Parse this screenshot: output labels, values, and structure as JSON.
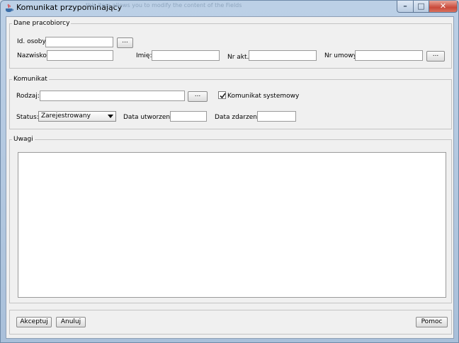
{
  "window": {
    "title": "Komunikat przypominający",
    "ghost_text": "this item allows you to modify the content of the Fields"
  },
  "pracobiorca": {
    "legend": "Dane pracobiorcy",
    "id_label": "Id. osoby:",
    "id_value": "",
    "nazwisko_label": "Nazwisko:",
    "nazwisko_value": "",
    "imie_label": "Imię:",
    "imie_value": "",
    "nr_akt_label": "Nr akt.:",
    "nr_akt_value": "",
    "nr_umowy_label": "Nr umowy:",
    "nr_umowy_value": "",
    "browse_label": "..."
  },
  "komunikat": {
    "legend": "Komunikat",
    "rodzaj_label": "Rodzaj:",
    "rodzaj_value": "",
    "browse_label": "...",
    "systemowy_label": "Komunikat systemowy",
    "systemowy_checked": true,
    "status_label": "Status:",
    "status_value": "Zarejestrowany",
    "data_utworzenia_label": "Data utworzenia:",
    "data_utworzenia_value": "",
    "data_zdarzenia_label": "Data zdarzenia:",
    "data_zdarzenia_value": ""
  },
  "uwagi": {
    "legend": "Uwagi",
    "value": ""
  },
  "footer": {
    "accept_label": "Akceptuj",
    "cancel_label": "Anuluj",
    "help_label": "Pomoc"
  }
}
